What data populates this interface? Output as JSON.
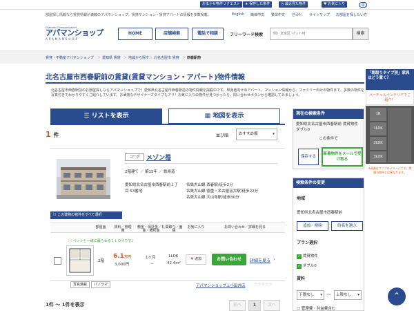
{
  "topbar": {
    "buttons": [
      "おまかせ物件リクエスト",
      "保存した条件",
      "最近見た物件",
      "お気に入り"
    ],
    "fav_count": "0"
  },
  "subbar": {
    "tagline": "部屋探し情報なら賃貸情報が満載のアパマンショップ。賃貸マンション・賃貸アパートの情報を多数掲載。",
    "langs": [
      "English",
      "簡体中文",
      "繁体中文",
      "한국어",
      "サイトマップ",
      "お部屋を探したい方"
    ]
  },
  "header": {
    "logo_small": "Dramatic Communication",
    "logo_main": "アパマンショップ",
    "logo_sub": "APAMANSHOP",
    "nav": [
      "HOME",
      "店舗検索",
      "電話で相談"
    ],
    "freeword_label": "フリーワード検索",
    "search_placeholder": "例）文京区 ペット可",
    "search_button": "検索"
  },
  "breadcrumb": [
    "賃貸・不動産アパマンショップ",
    "愛知県 賃貸",
    "地域から探す",
    "北名古屋市 賃貸",
    "西春駅前"
  ],
  "title": "北名古屋市西春駅前の賃貸(賃貸マンション・アパート)物件情報",
  "intro": "北名古屋市西春駅前のお部屋探しならアパマンショップで！愛知県北名古屋市西春駅前の物件情報を掲載中です。単身者向けのアパート、マンション情報から、ファミリー向けの物件まで、多数の物件を写真付きでわかりやすくご紹介しています。お洒落なデザイナーズタイプもアリ！お気に入りの物件が見つかったら、問い合わせボタンから確認してみましょう。",
  "tabs": {
    "list": "リストを表示",
    "map": "地図を表示"
  },
  "results": {
    "count": "1",
    "unit": "件",
    "sort_label": "並び順",
    "sort_value": "おすすめ順"
  },
  "listing": {
    "type": "コーポ",
    "name": "メゾン苺",
    "spec": "2階建て ／ 築15年 ／ 鉄骨造",
    "address": "愛知県北名古屋市西春駅前１丁目 53番地",
    "access": [
      "名鉄犬山線 西春駅/徒歩2分",
      "名鉄犬山線 徳重・名古屋芸大駅/徒歩22分",
      "名鉄犬山線 大山寺駅/徒歩30分"
    ],
    "select_all": "この建物の物件をすべて選択",
    "headers": [
      "部屋画",
      "賃料／管理費",
      "敷金・保証金／礼金・権利金",
      "間取り／面積",
      "お気に入り",
      "お問い合わせ／詳細を見る"
    ],
    "room": {
      "note": "ペットと一緒に暮らせる１ＬＤＫです♪",
      "floor": "2階",
      "rent": "6.1",
      "rent_unit": "万円",
      "fee": "3,000円",
      "deposit": "1ヶ月",
      "key_money": "－",
      "layout": "1LDK",
      "area": "42.4m²",
      "fav_button": "追加",
      "contact_button": "お問い合わせ",
      "detail_link": "詳細を見る",
      "photo_tags": [
        "写真満載",
        "パノラマ"
      ],
      "shop": "アパマンショップ上小田井店"
    }
  },
  "pager": {
    "summary": "1件 ～ 1件を表示",
    "prev": "前へ",
    "page": "1",
    "next": "次へ"
  },
  "sidebar": {
    "current_head": "現在の検索条件",
    "current_text": "愛知県北名古屋市西春駅前 賃貸物件 ダブル0",
    "save_label": "この条件で",
    "save_button": "保存する",
    "mail_button": "新着物件をメールで受け取る",
    "change_head": "検索条件の変更",
    "area_label": "地域",
    "area_value": "愛知県北名古屋市西春駅前",
    "area_buttons": [
      "追加・削除",
      "町名を選ぶ"
    ],
    "plan_label": "プラン選択",
    "plans": [
      "賃貸物件",
      "ダブル0"
    ],
    "rent_label": "賃料",
    "rent_min": "下限なし",
    "rent_sep": "～",
    "rent_max": "上限なし",
    "fee_label": "管理費・共益費含む"
  },
  "floatpanel": {
    "banner_title": "「間取りタイプ別」家具はどう置く？",
    "banner_sub": "バーチャルインテリアでご紹介！",
    "types": [
      "1R",
      "1LDK",
      "2LDK",
      "3LDK"
    ],
    "note": "※画像はサンプルイメージです。実際の物件とは異なります。"
  },
  "colors": {
    "brand": "#2a4b8d",
    "accent": "#e05a1e",
    "green": "#3aa63a"
  }
}
